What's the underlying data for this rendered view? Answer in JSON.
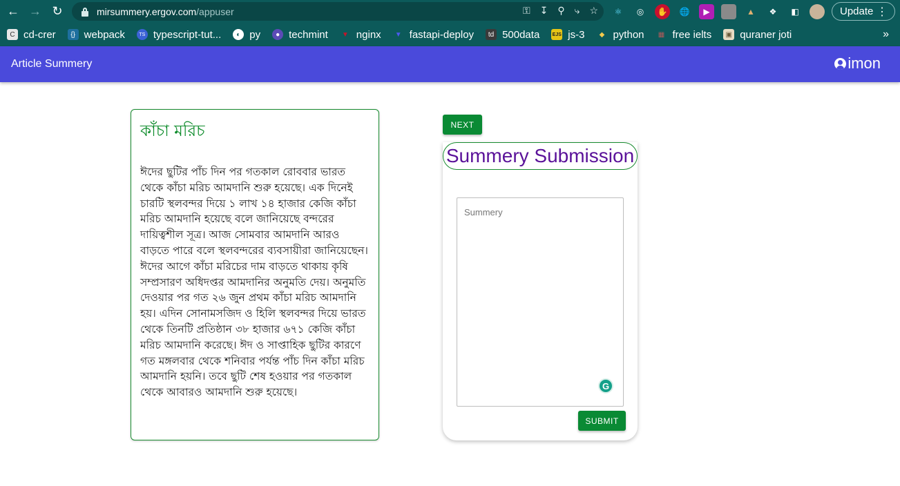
{
  "browser": {
    "url_host": "mirsummery.ergov.com",
    "url_path": "/appuser",
    "update_label": "Update",
    "bookmarks": [
      {
        "label": "cd-crer",
        "color": "#e8e8e8",
        "glyph": "C"
      },
      {
        "label": "webpack",
        "color": "#1e6f9f",
        "glyph": "{}"
      },
      {
        "label": "typescript-tut...",
        "color": "#3b62d6",
        "glyph": "TS"
      },
      {
        "label": "py",
        "color": "#ffffff",
        "glyph": "◐"
      },
      {
        "label": "techmint",
        "color": "#5b4bb6",
        "glyph": "●"
      },
      {
        "label": "nginx",
        "color": "#c4142a",
        "glyph": "▼"
      },
      {
        "label": "fastapi-deploy",
        "color": "#3b4ad6",
        "glyph": "▼"
      },
      {
        "label": "500data",
        "color": "#3a3a3a",
        "glyph": "td"
      },
      {
        "label": "js-3",
        "color": "#e6c515",
        "glyph": "EJS"
      },
      {
        "label": "python",
        "color": "#3c74b0",
        "glyph": "◆"
      },
      {
        "label": "free ielts",
        "color": "#b05a5a",
        "glyph": "▦"
      },
      {
        "label": "quraner joti",
        "color": "#bba98a",
        "glyph": "▣"
      }
    ]
  },
  "appbar": {
    "title": "Article Summery",
    "username": "imon",
    "color": "#4a4adb"
  },
  "article": {
    "title": "কাঁচা মরিচ",
    "body": "ঈদের ছুটির পাঁচ দিন পর গতকাল রোববার ভারত থেকে কাঁচা মরিচ আমদানি শুরু হয়েছে। এক দিনেই চারটি স্থলবন্দর দিয়ে ১ লাখ ১৪ হাজার কেজি কাঁচা মরিচ আমদানি হয়েছে বলে জানিয়েছে বন্দরের দায়িত্বশীল সূত্র। আজ সোমবার আমদানি আরও বাড়তে পারে বলে স্থলবন্দরের ব্যবসায়ীরা জানিয়েছেন। ঈদের আগে কাঁচা মরিচের দাম বাড়তে থাকায় কৃষি সম্প্রসারণ অধিদপ্তর আমদানির অনুমতি দেয়। অনুমতি দেওয়ার পর গত ২৬ জুন প্রথম কাঁচা মরিচ আমদানি হয়। এদিন সোনামসজিদ ও হিলি স্থলবন্দর দিয়ে ভারত থেকে তিনটি প্রতিষ্ঠান ৩৮ হাজার ৬৭১ কেজি কাঁচা মরিচ আমদানি করেছে। ঈদ ও সাপ্তাহিক ছুটির কারণে গত মঙ্গলবার থেকে শনিবার পর্যন্ত পাঁচ দিন কাঁচা মরিচ আমদানি হয়নি। তবে ছুটি শেষ হওয়ার পর গতকাল থেকে আবারও আমদানি শুরু হয়েছে।"
  },
  "submission": {
    "next_label": "NEXT",
    "heading": "Summery Submission",
    "summary_placeholder": "Summery",
    "summary_value": "",
    "submit_label": "SUBMIT",
    "accent_green": "#0a8a34",
    "heading_color": "#5a1299"
  }
}
